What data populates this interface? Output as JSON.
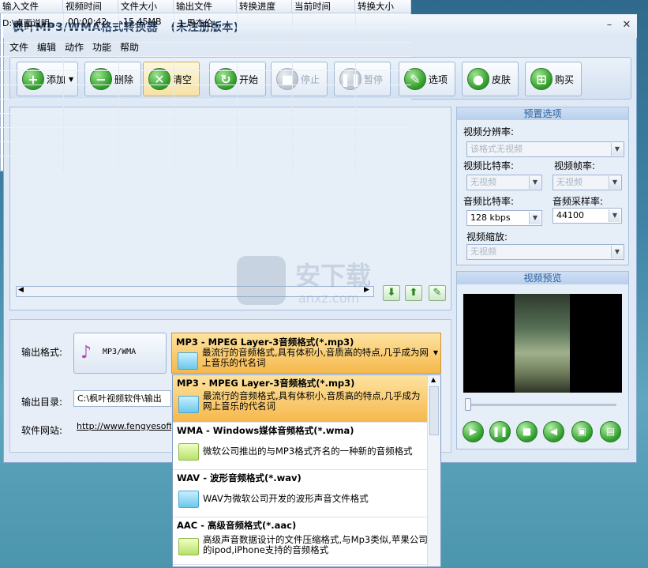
{
  "window": {
    "title": "枫叶MP3/WMA格式转换器",
    "subtitle": "(未注册版本)"
  },
  "menu": [
    "文件",
    "编辑",
    "动作",
    "功能",
    "帮助"
  ],
  "toolbar": {
    "add": "添加",
    "delete": "删除",
    "clear": "清空",
    "start": "开始",
    "stop": "停止",
    "pause": "暂停",
    "options": "选项",
    "skin": "皮肤",
    "buy": "购买"
  },
  "file_table": {
    "columns": [
      "输入文件",
      "视频时间",
      "文件大小",
      "输出文件",
      "转换进度",
      "当前时间",
      "转换大小"
    ],
    "rows": [
      [
        "D:\\桌面说明...",
        "00:00:42",
        "15.45MB",
        "1 周杰伦-...",
        "",
        "",
        ""
      ]
    ]
  },
  "preset": {
    "title": "预置选项",
    "video_resolution_label": "视频分辨率:",
    "video_resolution_value": "该格式无视频",
    "video_bitrate_label": "视频比特率:",
    "video_bitrate_value": "无视频",
    "video_framerate_label": "视频帧率:",
    "video_framerate_value": "无视频",
    "audio_bitrate_label": "音频比特率:",
    "audio_bitrate_value": "128 kbps",
    "audio_samplerate_label": "音频采样率:",
    "audio_samplerate_value": "44100",
    "video_scale_label": "视频缩放:",
    "video_scale_value": "无视频"
  },
  "preview": {
    "title": "视频预览"
  },
  "output": {
    "format_label": "输出格式:",
    "format_button": "MP3/WMA",
    "dir_label": "输出目录:",
    "dir_value": "C:\\枫叶视频软件\\输出",
    "site_label": "软件网站:",
    "site_value": "http://www.fengyesoft.c"
  },
  "selected_format": {
    "title": "MP3 - MPEG Layer-3音频格式(*.mp3)",
    "desc": "最流行的音频格式,具有体积小,音质高的特点,几乎成为网上音乐的代名词"
  },
  "format_options": [
    {
      "title": "MP3 - MPEG Layer-3音频格式(*.mp3)",
      "desc": "最流行的音频格式,具有体积小,音质高的特点,几乎成为网上音乐的代名词"
    },
    {
      "title": "WMA - Windows媒体音频格式(*.wma)",
      "desc": "微软公司推出的与MP3格式齐名的一种新的音频格式"
    },
    {
      "title": "WAV - 波形音频格式(*.wav)",
      "desc": "WAV为微软公司开发的波形声音文件格式"
    },
    {
      "title": "AAC - 高级音频格式(*.aac)",
      "desc": "高级声音数据设计的文件压缩格式,与Mp3类似,苹果公司的ipod,iPhone支持的音频格式"
    }
  ],
  "watermark": {
    "brand": "安下载",
    "domain": "anxz.com"
  }
}
